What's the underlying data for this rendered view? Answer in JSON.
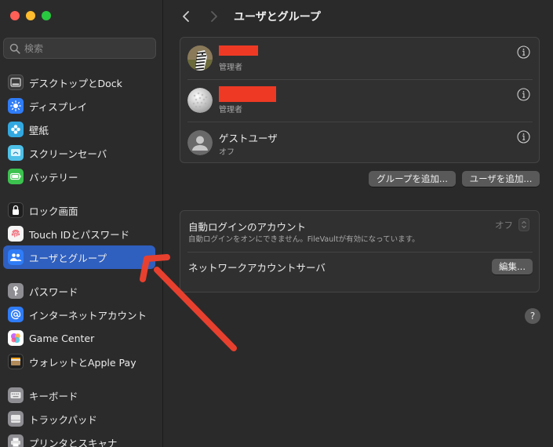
{
  "sidebar": {
    "search_placeholder": "検索",
    "items": [
      {
        "label": "デスクトップとDock",
        "icon": "dock-icon",
        "color": "#3b3b3b"
      },
      {
        "label": "ディスプレイ",
        "icon": "display-icon",
        "color": "#2f7cf6"
      },
      {
        "label": "壁紙",
        "icon": "wallpaper-icon",
        "color": "#33a8e0"
      },
      {
        "label": "スクリーンセーバ",
        "icon": "screensaver-icon",
        "color": "#4ec0e8"
      },
      {
        "label": "バッテリー",
        "icon": "battery-icon",
        "color": "#3cc24f"
      },
      {
        "label": "ロック画面",
        "icon": "lock-icon",
        "color": "#1e1e1e"
      },
      {
        "label": "Touch IDとパスワード",
        "icon": "fingerprint-icon",
        "color": "#f5f5f5"
      },
      {
        "label": "ユーザとグループ",
        "icon": "users-icon",
        "color": "#2f7cf6"
      },
      {
        "label": "パスワード",
        "icon": "key-icon",
        "color": "#8e8e93"
      },
      {
        "label": "インターネットアカウント",
        "icon": "at-icon",
        "color": "#2f7cf6"
      },
      {
        "label": "Game Center",
        "icon": "game-center-icon",
        "color": "#ffffff"
      },
      {
        "label": "ウォレットとApple Pay",
        "icon": "wallet-icon",
        "color": "#1e1e1e"
      },
      {
        "label": "キーボード",
        "icon": "keyboard-icon",
        "color": "#8e8e93"
      },
      {
        "label": "トラックパッド",
        "icon": "trackpad-icon",
        "color": "#8e8e93"
      },
      {
        "label": "プリンタとスキャナ",
        "icon": "printer-icon",
        "color": "#8e8e93"
      }
    ],
    "active_index": 7,
    "active_color": "#2f5fbf"
  },
  "main": {
    "title": "ユーザとグループ",
    "users": [
      {
        "name": "",
        "role": "管理者",
        "avatar": "zebra-avatar"
      },
      {
        "name": "",
        "role": "管理者",
        "avatar": "golf-ball-avatar"
      },
      {
        "name": "ゲストユーザ",
        "role": "オフ",
        "avatar": "guest-avatar"
      }
    ],
    "add_group_label": "グループを追加...",
    "add_user_label": "ユーザを追加...",
    "autologin": {
      "title": "自動ログインのアカウント",
      "description": "自動ログインをオンにできません。FileVaultが有効になっています。",
      "value": "オフ"
    },
    "network": {
      "label": "ネットワークアカウントサーバ",
      "edit_label": "編集..."
    },
    "help_label": "?"
  },
  "annotation": {
    "color": "#e8402e",
    "icon": "red-arrow"
  }
}
